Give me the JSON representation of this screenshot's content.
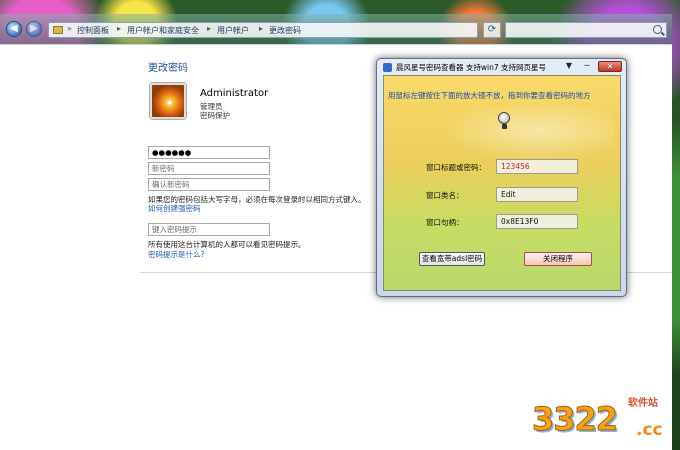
{
  "explorer": {
    "breadcrumbs": [
      "控制面板",
      "用户帐户和家庭安全",
      "用户帐户",
      "更改密码"
    ],
    "main": {
      "page_title": "更改密码",
      "user": {
        "name": "Administrator",
        "role": "管理员",
        "protection": "密码保护"
      },
      "current_password_mask": "●●●●●●",
      "new_password_placeholder": "新密码",
      "confirm_password_placeholder": "确认新密码",
      "caps_note": "如果您的密码包括大写字母，必须在每次登录时以相同方式键入。",
      "strong_password_link": "如何创建强密码",
      "hint_placeholder": "键入密码提示",
      "hint_note": "所有使用这台计算机的人都可以看见密码提示。",
      "hint_link": "密码提示是什么?"
    }
  },
  "tool_window": {
    "title": "晨风星号密码查看器 支持win7 支持网页星号",
    "hint": "用鼠标左键按住下面的放大镜不放，拖到你要查看密码的地方",
    "fields": [
      {
        "label": "窗口标题或密码：",
        "value": "123456"
      },
      {
        "label": "窗口类名：",
        "value": "Edit"
      },
      {
        "label": "窗口句柄：",
        "value": "0x8E13F0"
      }
    ],
    "buttons": {
      "view_broadband": "查看宽带adsl密码",
      "close_program": "关闭程序"
    },
    "controls": {
      "menu": "▼",
      "minimize": "─",
      "close": "✕"
    }
  },
  "watermark": {
    "digits": "3322",
    "tag": "软件站",
    "domain": ".cc"
  },
  "icons": [
    "back-arrow-icon",
    "forward-arrow-icon",
    "folder-icon",
    "refresh-icon",
    "search-icon",
    "user-avatar",
    "magnifier-icon"
  ],
  "colors": {
    "link": "#1f5bbf",
    "title": "#1e4f9c",
    "password_value": "#c1272d",
    "tool_bg": "#f9d96a"
  }
}
